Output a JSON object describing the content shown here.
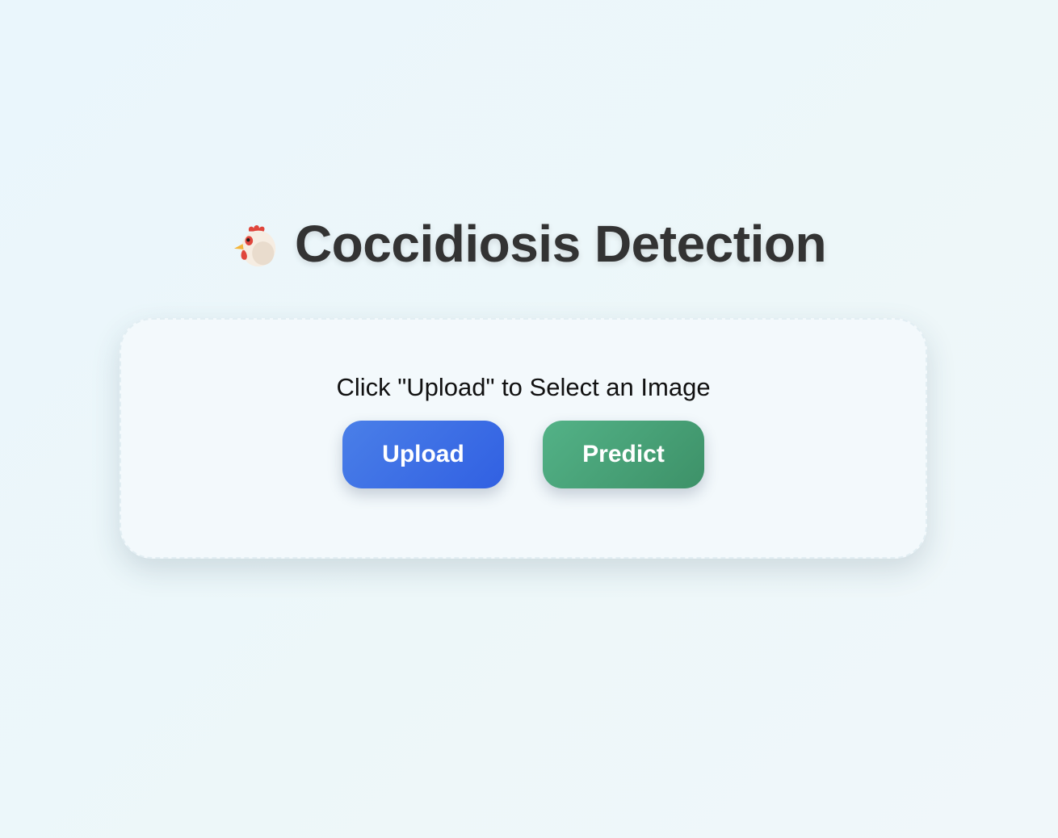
{
  "header": {
    "icon": "chicken-icon",
    "title": "Coccidiosis Detection"
  },
  "upload_panel": {
    "instruction": "Click \"Upload\" to Select an Image",
    "upload_label": "Upload",
    "predict_label": "Predict"
  },
  "colors": {
    "title_text": "#333333",
    "upload_button": "#3d6ee6",
    "predict_button": "#4aa27a",
    "card_background": "#f3f9fc",
    "page_background": "#ecf6fa"
  }
}
